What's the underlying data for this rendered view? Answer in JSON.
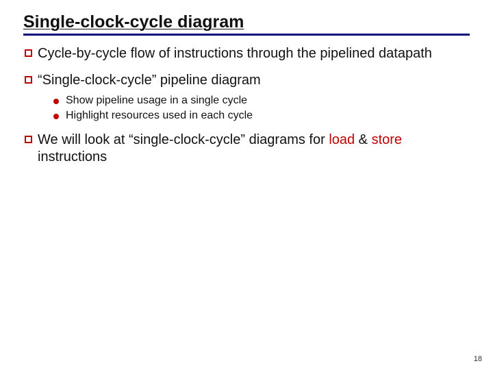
{
  "title": "Single-clock-cycle diagram",
  "bullets": {
    "b1": "Cycle-by-cycle flow of instructions through the pipelined datapath",
    "b2": "“Single-clock-cycle” pipeline diagram",
    "b2_sub": {
      "s1": "Show pipeline usage in a single cycle",
      "s2": "Highlight resources used in each cycle"
    },
    "b3_pre": "We will look at “single-clock-cycle” diagrams for ",
    "b3_load": "load",
    "b3_amp": " & ",
    "b3_store": "store",
    "b3_post": " instructions"
  },
  "page_number": "18"
}
